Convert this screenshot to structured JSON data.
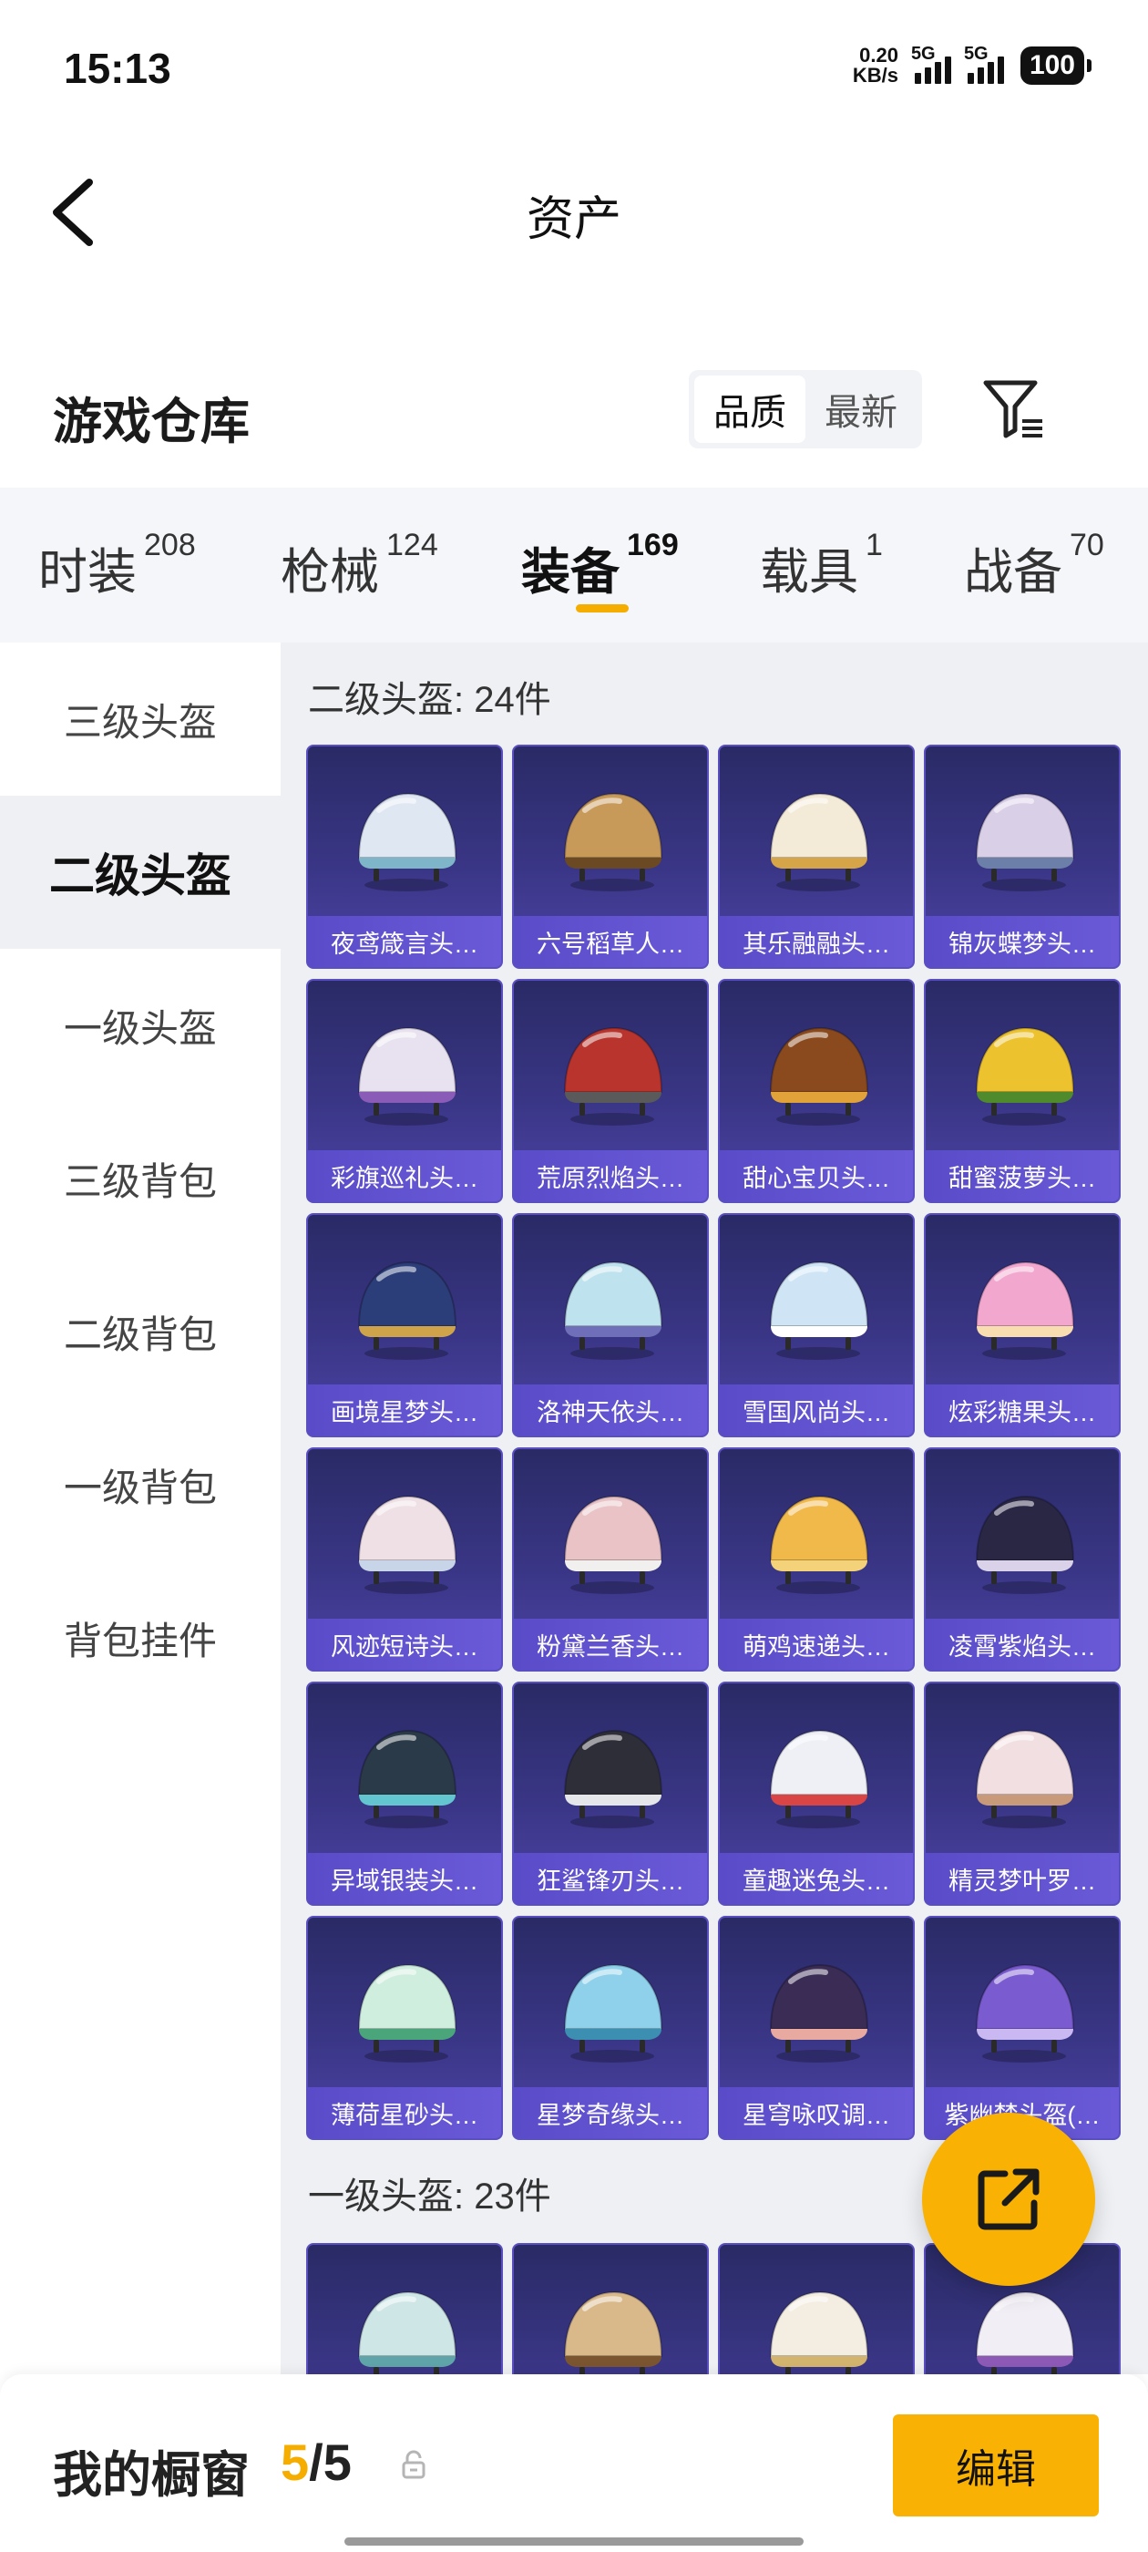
{
  "status_bar": {
    "time": "15:13",
    "net_speed_value": "0.20",
    "net_speed_unit": "KB/s",
    "sim1": "5G",
    "sim2": "5G",
    "battery": "100"
  },
  "header": {
    "title": "资产"
  },
  "warehouse": {
    "title": "游戏仓库",
    "sort_options": [
      "品质",
      "最新"
    ],
    "sort_selected": "品质"
  },
  "tabs": [
    {
      "label": "时装",
      "count": "208"
    },
    {
      "label": "枪械",
      "count": "124"
    },
    {
      "label": "装备",
      "count": "169",
      "active": true
    },
    {
      "label": "载具",
      "count": "1"
    },
    {
      "label": "战备",
      "count": "70"
    }
  ],
  "sidebar": {
    "items": [
      "三级头盔",
      "二级头盔",
      "一级头盔",
      "三级背包",
      "二级背包",
      "一级背包",
      "背包挂件"
    ],
    "active_index": 1
  },
  "sections": [
    {
      "title": "二级头盔: 24件",
      "items": [
        {
          "name": "夜鸢箴言头…",
          "color": "#dfe7f2",
          "accent": "#7fb5c9"
        },
        {
          "name": "六号稻草人…",
          "color": "#c89a5a",
          "accent": "#6b4a23"
        },
        {
          "name": "其乐融融头…",
          "color": "#f3ead8",
          "accent": "#d6a548"
        },
        {
          "name": "锦灰蝶梦头…",
          "color": "#d9cfe6",
          "accent": "#6b7fa8"
        },
        {
          "name": "彩旗巡礼头…",
          "color": "#e8e2f0",
          "accent": "#8b5bb8"
        },
        {
          "name": "荒原烈焰头…",
          "color": "#b8342c",
          "accent": "#5a5a5a"
        },
        {
          "name": "甜心宝贝头…",
          "color": "#8a4a1e",
          "accent": "#e2a23a"
        },
        {
          "name": "甜蜜菠萝头…",
          "color": "#ecc22e",
          "accent": "#4f8a2c"
        },
        {
          "name": "画境星梦头…",
          "color": "#2c3e7a",
          "accent": "#cfa34a"
        },
        {
          "name": "洛神天依头…",
          "color": "#bfe3ee",
          "accent": "#6e6fb8"
        },
        {
          "name": "雪国风尚头…",
          "color": "#cfe5f5",
          "accent": "#ffffff"
        },
        {
          "name": "炫彩糖果头…",
          "color": "#f2a7cf",
          "accent": "#f7ddb0"
        },
        {
          "name": "风迹短诗头…",
          "color": "#efe0e6",
          "accent": "#c8d4e8"
        },
        {
          "name": "粉黛兰香头…",
          "color": "#e9c3c6",
          "accent": "#f2f0ee"
        },
        {
          "name": "萌鸡速递头…",
          "color": "#f0b94a",
          "accent": "#f4d27a"
        },
        {
          "name": "凌霄紫焰头…",
          "color": "#2a2745",
          "accent": "#d9d2e8"
        },
        {
          "name": "异域银装头…",
          "color": "#2b3a48",
          "accent": "#62c5cf"
        },
        {
          "name": "狂鲨锋刃头…",
          "color": "#2e2e38",
          "accent": "#e4e6ea"
        },
        {
          "name": "童趣迷兔头…",
          "color": "#eef0f5",
          "accent": "#d94545"
        },
        {
          "name": "精灵梦叶罗…",
          "color": "#f1dfe2",
          "accent": "#c99a7a"
        },
        {
          "name": "薄荷星砂头…",
          "color": "#cfeede",
          "accent": "#4aa67a"
        },
        {
          "name": "星梦奇缘头…",
          "color": "#8fd0ea",
          "accent": "#3c8fb0"
        },
        {
          "name": "星穹咏叹调…",
          "color": "#3a2c54",
          "accent": "#e8a9a0"
        },
        {
          "name": "紫幽梦头盔(…",
          "color": "#7b5bd0",
          "accent": "#c9b8f2"
        }
      ]
    },
    {
      "title": "一级头盔: 23件",
      "items": [
        {
          "name": "",
          "color": "#cfe6e6",
          "accent": "#5fa4a8"
        },
        {
          "name": "",
          "color": "#d9b98a",
          "accent": "#7a5530"
        },
        {
          "name": "",
          "color": "#f3ede2",
          "accent": "#d2b46e"
        },
        {
          "name": "",
          "color": "#f2eef5",
          "accent": "#8c5ab6"
        }
      ]
    }
  ],
  "bottom_bar": {
    "label": "我的橱窗",
    "count_current": "5",
    "count_separator": "/5",
    "edit_label": "编辑"
  }
}
